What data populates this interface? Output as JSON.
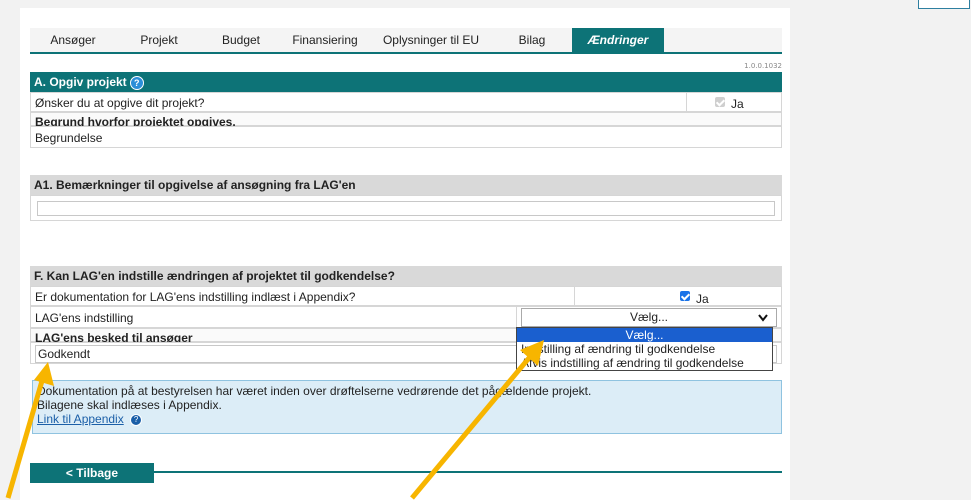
{
  "tabs": [
    {
      "label": "Ansøger"
    },
    {
      "label": "Projekt"
    },
    {
      "label": "Budget"
    },
    {
      "label": "Finansiering"
    },
    {
      "label": "Oplysninger til EU"
    },
    {
      "label": "Bilag"
    },
    {
      "label": "Ændringer"
    }
  ],
  "active_tab": "Ændringer",
  "version": "1.0.0.1032",
  "section_a": {
    "title": "A. Opgiv projekt",
    "help_icon": "?",
    "question": "Ønsker du at opgive dit projekt?",
    "checkbox_label": "Ja",
    "checked": true,
    "reason_label": "Begrund hvorfor projektet opgives.",
    "reason_value": "Begrundelse"
  },
  "section_a1": {
    "title": "A1. Bemærkninger til opgivelse af ansøgning fra LAG'en",
    "input_value": ""
  },
  "section_f": {
    "title": "F. Kan LAG'en indstille ændringen af projektet til godkendelse?",
    "question": "Er dokumentation for LAG'ens indstilling indlæst i Appendix?",
    "checkbox_label": "Ja",
    "checked": true,
    "indstilling_label": "LAG'ens indstilling",
    "select_value": "Vælg...",
    "options": [
      "Vælg...",
      "Indstilling af ændring til godkendelse",
      "Afvis indstilling af ændring til godkendelse"
    ],
    "besked_label": "LAG'ens besked til ansøger",
    "besked_value": "Godkendt",
    "info_line1": "Dokumentation på at bestyrelsen har været inden over drøftelserne vedrørende det pågældende projekt.",
    "info_line2": "Bilagene skal indlæses i Appendix.",
    "info_link": "Link til Appendix"
  },
  "back_button": "< Tilbage",
  "colors": {
    "teal": "#0d7377",
    "arrow": "#f7b500",
    "link": "#1b5fa8"
  }
}
